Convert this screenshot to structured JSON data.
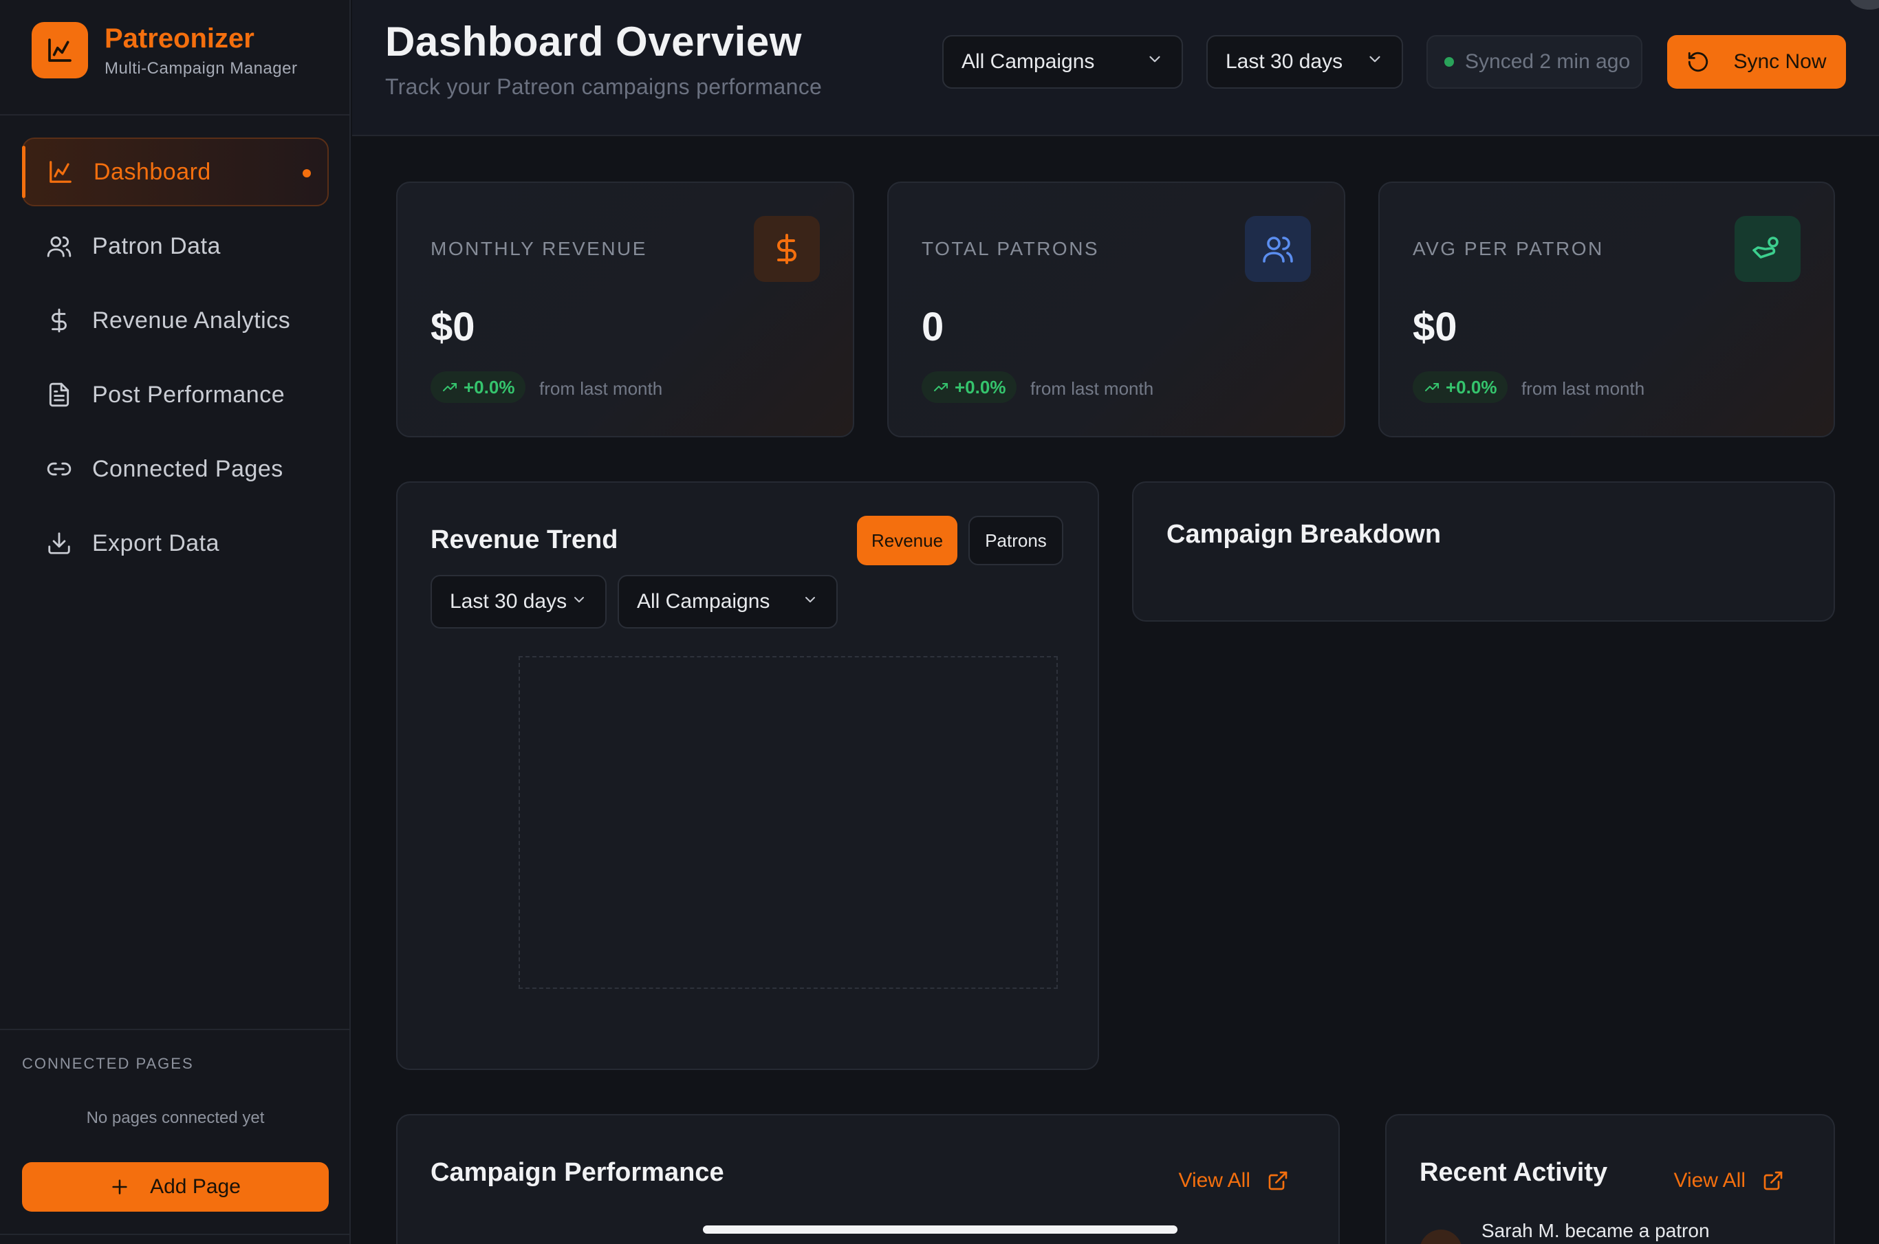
{
  "app": {
    "name": "Patreonizer",
    "subtitle": "Multi-Campaign Manager"
  },
  "sidebar": {
    "items": [
      {
        "label": "Dashboard",
        "icon": "chart-icon",
        "active": true
      },
      {
        "label": "Patron Data",
        "icon": "users-icon"
      },
      {
        "label": "Revenue Analytics",
        "icon": "dollar-icon"
      },
      {
        "label": "Post Performance",
        "icon": "document-icon"
      },
      {
        "label": "Connected Pages",
        "icon": "link-icon"
      },
      {
        "label": "Export Data",
        "icon": "download-icon"
      }
    ],
    "connected_pages_label": "CONNECTED PAGES",
    "empty_text": "No pages connected yet",
    "add_page_label": "Add Page"
  },
  "header": {
    "title": "Dashboard Overview",
    "subtitle": "Track your Patreon campaigns performance",
    "campaign_select": "All Campaigns",
    "range_select": "Last 30 days",
    "sync_status": "Synced 2 min ago",
    "sync_button": "Sync Now"
  },
  "stats": [
    {
      "label": "MONTHLY REVENUE",
      "value": "$0",
      "trend": "+0.0%",
      "note": "from last month",
      "icon": "dollar-icon"
    },
    {
      "label": "TOTAL PATRONS",
      "value": "0",
      "trend": "+0.0%",
      "note": "from last month",
      "icon": "users-icon"
    },
    {
      "label": "AVG PER PATRON",
      "value": "$0",
      "trend": "+0.0%",
      "note": "from last month",
      "icon": "hand-coin-icon"
    }
  ],
  "revenue_trend": {
    "title": "Revenue Trend",
    "toggle_revenue": "Revenue",
    "toggle_patrons": "Patrons",
    "range_select": "Last 30 days",
    "campaign_select": "All Campaigns"
  },
  "campaign_breakdown": {
    "title": "Campaign Breakdown"
  },
  "campaign_performance": {
    "title": "Campaign Performance",
    "view_all": "View All"
  },
  "recent_activity": {
    "title": "Recent Activity",
    "view_all": "View All",
    "items": [
      {
        "text": "Sarah M. became a patron"
      }
    ]
  },
  "colors": {
    "accent": "#f46f0e",
    "background": "#111318",
    "card": "#181b22",
    "positive": "#35c46d",
    "patrons_icon": "#5b8ef0",
    "avg_icon": "#3ccf8e"
  }
}
